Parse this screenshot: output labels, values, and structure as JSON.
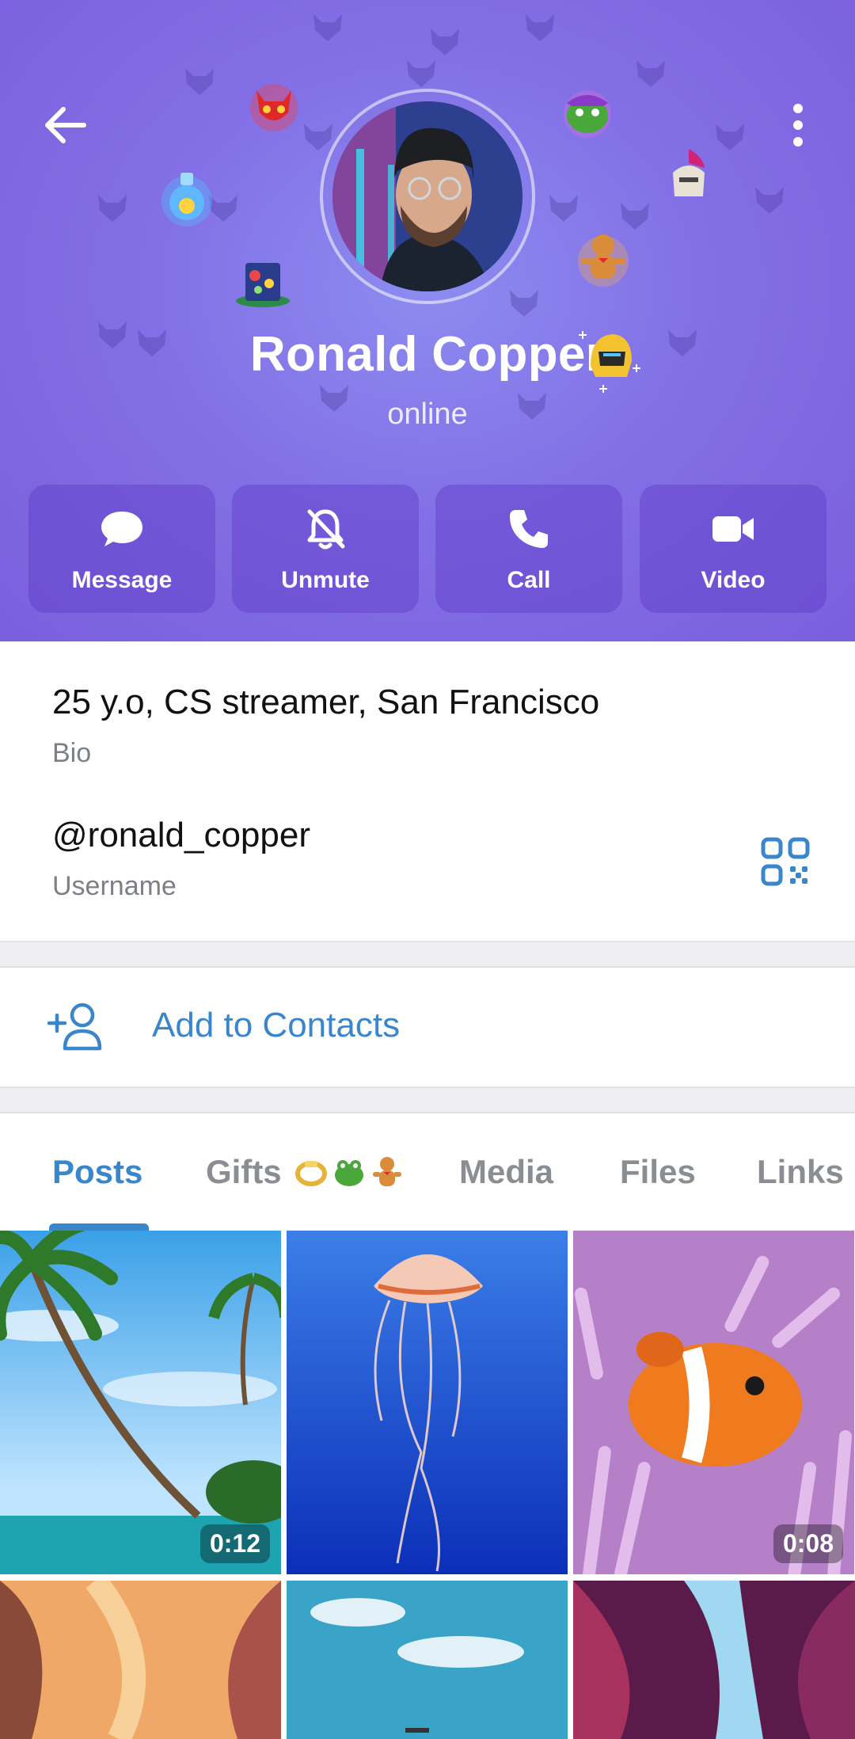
{
  "header": {
    "back_icon": "arrow-left-icon",
    "menu_icon": "more-vertical-icon",
    "name": "Ronald Copper",
    "status": "online",
    "colors": {
      "background": "#8370e6",
      "button": "#6a4fd0"
    }
  },
  "actions": [
    {
      "label": "Message",
      "icon": "message-bubble-icon"
    },
    {
      "label": "Unmute",
      "icon": "bell-off-icon"
    },
    {
      "label": "Call",
      "icon": "phone-icon"
    },
    {
      "label": "Video",
      "icon": "video-camera-icon"
    }
  ],
  "info": {
    "bio": {
      "value": "25 y.o, CS streamer, San Francisco",
      "label": "Bio"
    },
    "username": {
      "value": "@ronald_copper",
      "label": "Username",
      "icon": "qr-code-icon"
    }
  },
  "add_contact": {
    "label": "Add to Contacts",
    "icon": "person-add-icon"
  },
  "tabs": [
    {
      "label": "Posts",
      "active": true
    },
    {
      "label": "Gifts",
      "active": false
    },
    {
      "label": "Media",
      "active": false
    },
    {
      "label": "Files",
      "active": false
    },
    {
      "label": "Links",
      "active": false
    }
  ],
  "accent_color": "#3a86cc",
  "posts": [
    {
      "kind": "video",
      "duration": "0:12",
      "subject": "palm-beach"
    },
    {
      "kind": "photo",
      "subject": "jellyfish"
    },
    {
      "kind": "video",
      "duration": "0:08",
      "subject": "clownfish"
    },
    {
      "kind": "photo",
      "subject": "canyon"
    },
    {
      "kind": "photo",
      "subject": "sea-sky"
    },
    {
      "kind": "photo",
      "subject": "canyon-purple"
    }
  ]
}
